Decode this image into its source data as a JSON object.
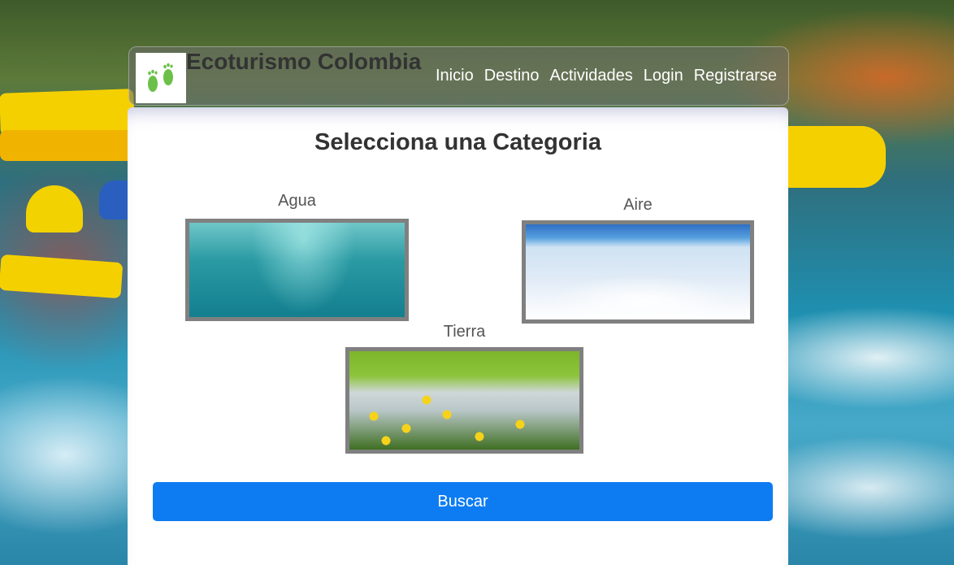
{
  "header": {
    "brand": "Ecoturismo Colombia",
    "logo_icon": "footprints-icon",
    "nav": [
      "Inicio",
      "Destino",
      "Actividades",
      "Login",
      "Registrarse"
    ]
  },
  "main": {
    "title": "Selecciona una Categoria",
    "categories": [
      {
        "label": "Agua",
        "image": "underwater-photo"
      },
      {
        "label": "Aire",
        "image": "clouds-photo"
      },
      {
        "label": "Tierra",
        "image": "tulip-field-photo"
      }
    ],
    "search_button": "Buscar"
  },
  "colors": {
    "button": "#0d7cf2",
    "brand_text": "#333333",
    "logo_green": "#6cc04a"
  }
}
